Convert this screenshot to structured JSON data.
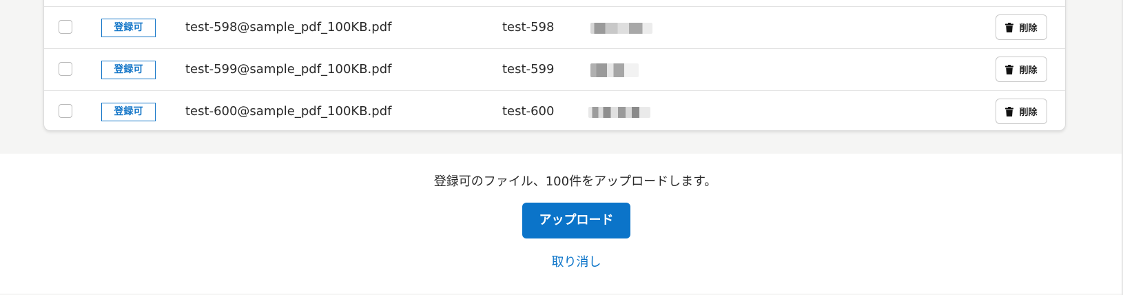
{
  "rows": [
    {
      "status": "登録可",
      "file_name": "test-598@sample_pdf_100KB.pdf",
      "title": "test-598",
      "delete_label": "削除"
    },
    {
      "status": "登録可",
      "file_name": "test-599@sample_pdf_100KB.pdf",
      "title": "test-599",
      "delete_label": "削除"
    },
    {
      "status": "登録可",
      "file_name": "test-600@sample_pdf_100KB.pdf",
      "title": "test-600",
      "delete_label": "削除"
    }
  ],
  "footer": {
    "message": "登録可のファイル、100件をアップロードします。",
    "upload_label": "アップロード",
    "cancel_label": "取り消し"
  },
  "colors": {
    "accent": "#0b74c9",
    "badge_border": "#1677c8",
    "page_background": "#f5f5f4"
  },
  "icons": {
    "delete": "trash-icon"
  }
}
